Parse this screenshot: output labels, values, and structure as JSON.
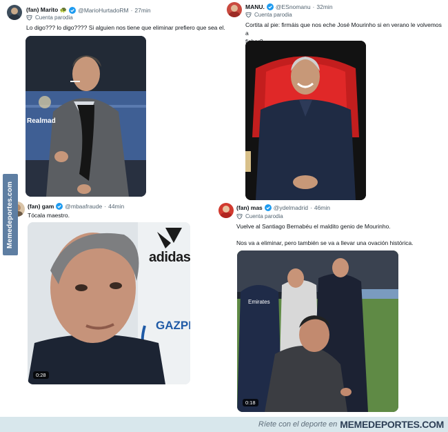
{
  "tweets": [
    {
      "name": "(fan) Marito 🐢",
      "handle": "@MarioHurtadoRM",
      "sep": "·",
      "time": "27min",
      "parody": "Cuenta parodia",
      "text": "Lo digo??? lo digo???? Si alguien nos tiene que eliminar prefiero que sea el."
    },
    {
      "name": "MANU.",
      "handle": "@ESnomanu",
      "sep": "·",
      "time": "32min",
      "parody": "Cuenta parodia",
      "text_line1": "Cortita al pie: firmáis que nos eche José Mourinho si en verano le volvemos a",
      "text_line2": "fichar?"
    },
    {
      "name": "(fan) gam",
      "handle": "@mbaafraude",
      "sep": "·",
      "time": "44min",
      "text": "Tócala maestro.",
      "duration": "0:28",
      "logo_text": "adidas",
      "sponsor_text": "GAZPR"
    },
    {
      "name": "(fan) mas",
      "handle": "@ydelmadrid",
      "sep": "·",
      "time": "46min",
      "parody": "Cuenta parodia",
      "text_line1": "Vuelve al Santiago Bernabéu el maldito genio de Mourinho.",
      "text_line2": "Nos va a eliminar, pero también se va a llevar una ovación histórica.",
      "duration": "0:18",
      "jacket_text": "Emirates"
    }
  ],
  "photo1_overlay": "Realmad",
  "sidebar_watermark": "Memedeportes.com",
  "footer": {
    "text": "Ríete con el deporte en",
    "brand": "MEMEDEPORTES.COM"
  },
  "icons": {
    "verified": "verified-badge-icon",
    "parody": "parody-mask-icon"
  },
  "colors": {
    "verified": "#1d9bf0",
    "meta_gray": "#536471",
    "footer_bg": "#d8e7ec",
    "watermark_bg": "#5e7ea2"
  }
}
